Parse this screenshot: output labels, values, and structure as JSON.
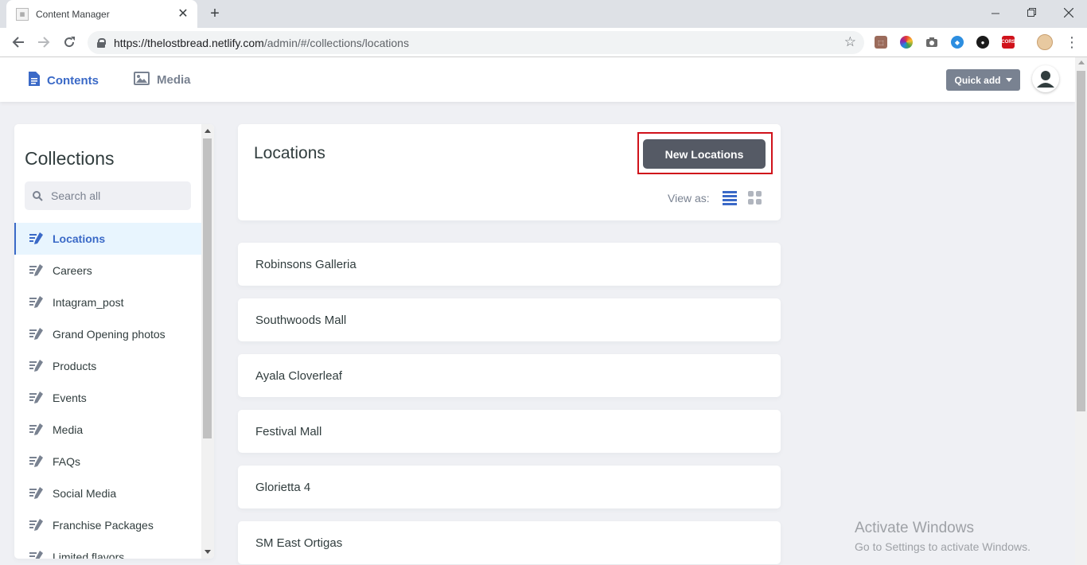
{
  "browser": {
    "tab_title": "Content Manager",
    "tab_close": "✕",
    "new_tab": "+",
    "url_host": "https://thelostbread.netlify.com",
    "url_path": "/admin/#/collections/locations",
    "extensions": [
      "pdf-extension-icon",
      "color-picker-extension-icon",
      "camera-extension-icon",
      "blue-drop-extension-icon",
      "dark-circle-extension-icon",
      "cors-extension-icon"
    ],
    "ext_cors_label": "CORS"
  },
  "header": {
    "nav": [
      {
        "label": "Contents",
        "active": true
      },
      {
        "label": "Media",
        "active": false
      }
    ],
    "quick_add": "Quick add"
  },
  "sidebar": {
    "title": "Collections",
    "search_placeholder": "Search all",
    "items": [
      {
        "label": "Locations",
        "active": true
      },
      {
        "label": "Careers"
      },
      {
        "label": "Intagram_post"
      },
      {
        "label": "Grand Opening photos"
      },
      {
        "label": "Products"
      },
      {
        "label": "Events"
      },
      {
        "label": "Media"
      },
      {
        "label": "FAQs"
      },
      {
        "label": "Social Media"
      },
      {
        "label": "Franchise Packages"
      },
      {
        "label": "Limited flavors"
      }
    ]
  },
  "collection": {
    "title": "Locations",
    "new_button": "New Locations",
    "view_as": "View as:",
    "entries": [
      "Robinsons Galleria",
      "Southwoods Mall",
      "Ayala Cloverleaf",
      "Festival Mall",
      "Glorietta 4",
      "SM East Ortigas"
    ]
  },
  "watermark": {
    "line1": "Activate Windows",
    "line2": "Go to Settings to activate Windows."
  },
  "colors": {
    "accent": "#3a69c7",
    "highlight_border": "#d0121b",
    "new_button_bg": "#555a65",
    "quick_add_bg": "#798291"
  }
}
